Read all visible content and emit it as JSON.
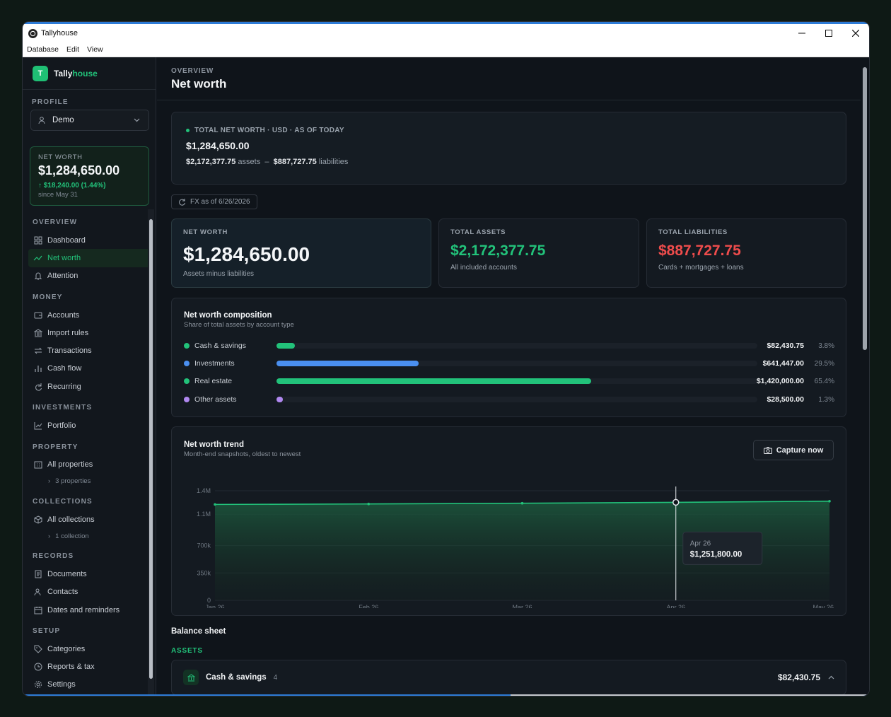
{
  "window": {
    "title": "Tallyhouse",
    "menu": [
      "Database",
      "Edit",
      "View"
    ]
  },
  "brand": {
    "letter": "T",
    "name_a": "Tally",
    "name_b": "house"
  },
  "profile": {
    "label": "PROFILE",
    "value": "Demo"
  },
  "sidebar_networth": {
    "label": "NET WORTH",
    "value": "$1,284,650.00",
    "delta": "↑ $18,240.00 (1.44%)",
    "since": "since May 31"
  },
  "nav": {
    "overview": {
      "label": "OVERVIEW",
      "items": [
        "Dashboard",
        "Net worth",
        "Attention"
      ]
    },
    "money": {
      "label": "MONEY",
      "items": [
        "Accounts",
        "Import rules",
        "Transactions",
        "Cash flow",
        "Recurring"
      ]
    },
    "investments": {
      "label": "INVESTMENTS",
      "items": [
        "Portfolio"
      ]
    },
    "property": {
      "label": "PROPERTY",
      "items": [
        "All properties"
      ],
      "sub": "3 properties"
    },
    "collections": {
      "label": "COLLECTIONS",
      "items": [
        "All collections"
      ],
      "sub": "1 collection"
    },
    "records": {
      "label": "RECORDS",
      "items": [
        "Documents",
        "Contacts",
        "Dates and reminders"
      ]
    },
    "setup": {
      "label": "SETUP",
      "items": [
        "Categories",
        "Reports & tax",
        "Settings"
      ]
    }
  },
  "header": {
    "section": "OVERVIEW",
    "title": "Net worth"
  },
  "hero": {
    "caption": "TOTAL NET WORTH · USD · AS OF TODAY",
    "value": "$1,284,650.00",
    "assets": "$2,172,377.75",
    "assets_word": "assets",
    "sep": "–",
    "liabilities": "$887,727.75",
    "liabilities_word": "liabilities"
  },
  "fx": "FX as of 6/26/2026",
  "stats": [
    {
      "label": "NET WORTH",
      "value": "$1,284,650.00",
      "sub": "Assets minus liabilities",
      "color": "#f4f6f8"
    },
    {
      "label": "TOTAL ASSETS",
      "value": "$2,172,377.75",
      "sub": "All included accounts",
      "color": "#22c27a"
    },
    {
      "label": "TOTAL LIABILITIES",
      "value": "$887,727.75",
      "sub": "Cards + mortgages + loans",
      "color": "#ef4c4c"
    }
  ],
  "composition": {
    "title": "Net worth composition",
    "subtitle": "Share of total assets by account type",
    "rows": [
      {
        "name": "Cash & savings",
        "amount": "$82,430.75",
        "pct": "3.8%",
        "share": 0.038,
        "color": "#22c27a"
      },
      {
        "name": "Investments",
        "amount": "$641,447.00",
        "pct": "29.5%",
        "share": 0.295,
        "color": "#4a8ff0"
      },
      {
        "name": "Real estate",
        "amount": "$1,420,000.00",
        "pct": "65.4%",
        "share": 0.654,
        "color": "#22c27a"
      },
      {
        "name": "Other assets",
        "amount": "$28,500.00",
        "pct": "1.3%",
        "share": 0.013,
        "color": "#b088f0"
      }
    ]
  },
  "trend": {
    "title": "Net worth trend",
    "subtitle": "Month-end snapshots, oldest to newest",
    "capture": "Capture now",
    "tooltip": {
      "label": "Apr 26",
      "value": "$1,251,800.00"
    }
  },
  "chart_data": {
    "type": "area",
    "x": [
      "Jan 26",
      "Feb 26",
      "Mar 26",
      "Apr 26",
      "May 26"
    ],
    "series": [
      {
        "values": [
          1225000,
          1231000,
          1240000,
          1251800,
          1266410
        ]
      }
    ],
    "yticks": [
      "0",
      "350k",
      "700k",
      "1.1M",
      "1.4M"
    ],
    "ylim": [
      0,
      1400000
    ],
    "grid": true,
    "color": "#22c27a"
  },
  "balance": {
    "title": "Balance sheet",
    "assets_label": "ASSETS",
    "row": {
      "name": "Cash & savings",
      "count": "4",
      "amount": "$82,430.75"
    }
  }
}
